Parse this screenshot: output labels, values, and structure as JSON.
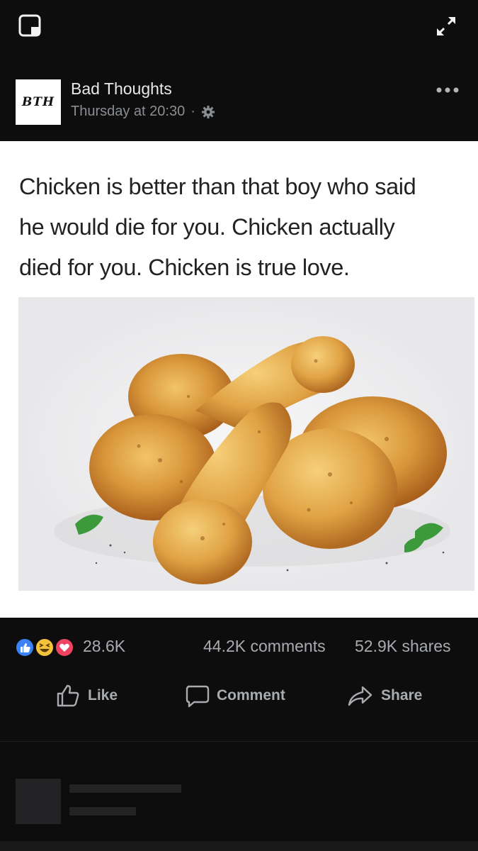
{
  "header": {
    "top_left_icon": "pip-square-icon",
    "top_right_icon": "expand-arrows-icon"
  },
  "post": {
    "avatar_text": "BTH",
    "page_name": "Bad Thoughts",
    "timestamp": "Thursday at 20:30",
    "separator": "·",
    "privacy_icon": "gear-icon",
    "more_icon": "ellipsis-icon"
  },
  "meme": {
    "lines": [
      "Chicken is better than that boy who said",
      "he would die for you. Chicken actually",
      "died for you. Chicken is true love."
    ],
    "image_subject": "fried-chicken-photo"
  },
  "stats": {
    "reaction_icons": [
      "like-reaction-icon",
      "haha-reaction-icon",
      "love-reaction-icon"
    ],
    "reactions": "28.6K",
    "comments": "44.2K comments",
    "shares": "52.9K shares"
  },
  "actions": {
    "like": "Like",
    "comment": "Comment",
    "share": "Share"
  },
  "colors": {
    "background": "#0d0d0e",
    "like_blue": "#3b82f6",
    "haha_yellow": "#f5c33b",
    "love_red": "#ef4461",
    "muted_text": "#a8abaf"
  }
}
